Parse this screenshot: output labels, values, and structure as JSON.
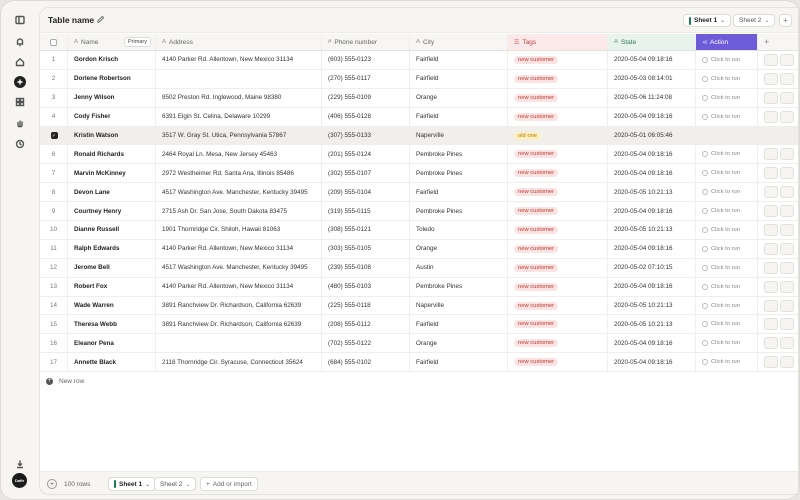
{
  "window": {
    "title": "Table name"
  },
  "sheets": [
    {
      "label": "Sheet 1",
      "active": true
    },
    {
      "label": "Sheet 2",
      "active": false
    }
  ],
  "columns": {
    "name": "Name",
    "primary_badge": "Primary",
    "address": "Address",
    "phone": "Phone number",
    "city": "City",
    "tags": "Tags",
    "state": "State",
    "action": "Action"
  },
  "rows": [
    {
      "idx": "1",
      "name": "Gordon Krisch",
      "address": "4140 Parker Rd. Allentown, New Mexico 31134",
      "phone": "(603) 555-0123",
      "city": "Fairfield",
      "tag": "new customer",
      "state": "2020-05-04 09:18:16",
      "action": "Click to run"
    },
    {
      "idx": "2",
      "name": "Dorlene Robertson",
      "address": "",
      "phone": "(270) 555-0117",
      "city": "Fairfield",
      "tag": "new customer",
      "state": "2020-05-03 08:14:01",
      "action": "Click to run"
    },
    {
      "idx": "3",
      "name": "Jenny Wilson",
      "address": "8502 Preston Rd. Inglewood, Maine 98380",
      "phone": "(229) 555-0109",
      "city": "Orange",
      "tag": "new customer",
      "state": "2020-05-06 11:24:08",
      "action": "Click to run"
    },
    {
      "idx": "4",
      "name": "Cody Fisher",
      "address": "6391 Elgin St. Celina, Delaware 10299",
      "phone": "(406) 555-0128",
      "city": "Fairfield",
      "tag": "new customer",
      "state": "2020-05-04 09:18:16",
      "action": "Click to run"
    },
    {
      "idx": "",
      "name": "Kristin Watson",
      "address": "3517 W. Gray St. Utica, Pennsylvania 57867",
      "phone": "(307) 555-0133",
      "city": "Naperville",
      "tag": "old one",
      "state": "2020-05-01 06:05:46",
      "action": "",
      "selected": true
    },
    {
      "idx": "6",
      "name": "Ronald Richards",
      "address": "2464 Royal Ln. Mesa, New Jersey 45463",
      "phone": "(201) 555-0124",
      "city": "Pembroke Pines",
      "tag": "new customer",
      "state": "2020-05-04 09:18:16",
      "action": "Click to run"
    },
    {
      "idx": "7",
      "name": "Marvin McKinney",
      "address": "2972 Westheimer Rd. Santa Ana, Illinois 85486",
      "phone": "(302) 555-0107",
      "city": "Pembroke Pines",
      "tag": "new customer",
      "state": "2020-05-04 09:18:16",
      "action": "Click to run"
    },
    {
      "idx": "8",
      "name": "Devon Lane",
      "address": "4517 Washington Ave. Manchester, Kentucky 39495",
      "phone": "(209) 555-0104",
      "city": "Fairfield",
      "tag": "new customer",
      "state": "2020-05-05 10:21:13",
      "action": "Click to run"
    },
    {
      "idx": "9",
      "name": "Courtney Henry",
      "address": "2715 Ash Dr. San Jose, South Dakota 83475",
      "phone": "(319) 555-0115",
      "city": "Pembroke Pines",
      "tag": "new customer",
      "state": "2020-05-04 09:18:16",
      "action": "Click to run"
    },
    {
      "idx": "10",
      "name": "Dianne Russell",
      "address": "1901 Thornridge Cir. Shiloh, Hawaii 81063",
      "phone": "(308) 555-0121",
      "city": "Toledo",
      "tag": "new customer",
      "state": "2020-05-05 10:21:13",
      "action": "Click to run"
    },
    {
      "idx": "11",
      "name": "Ralph Edwards",
      "address": "4140 Parker Rd. Allentown, New Mexico 31134",
      "phone": "(303) 555-0105",
      "city": "Orange",
      "tag": "new customer",
      "state": "2020-05-04 09:18:16",
      "action": "Click to run"
    },
    {
      "idx": "12",
      "name": "Jerome Bell",
      "address": "4517 Washington Ave. Manchester, Kentucky 39495",
      "phone": "(239) 555-0108",
      "city": "Austin",
      "tag": "new customer",
      "state": "2020-05-02 07:10:15",
      "action": "Click to run"
    },
    {
      "idx": "13",
      "name": "Robert Fox",
      "address": "4140 Parker Rd. Allentown, New Mexico 31134",
      "phone": "(480) 555-0103",
      "city": "Pembroke Pines",
      "tag": "new customer",
      "state": "2020-05-04 09:18:16",
      "action": "Click to run"
    },
    {
      "idx": "14",
      "name": "Wade Warren",
      "address": "3891 Ranchview Dr. Richardson, California 62639",
      "phone": "(225) 555-0118",
      "city": "Naperville",
      "tag": "new customer",
      "state": "2020-05-05 10:21:13",
      "action": "Click to run"
    },
    {
      "idx": "15",
      "name": "Theresa Webb",
      "address": "3891 Ranchview Dr. Richardson, California 62639",
      "phone": "(208) 555-0112",
      "city": "Fairfield",
      "tag": "new customer",
      "state": "2020-05-05 10:21:13",
      "action": "Click to run"
    },
    {
      "idx": "16",
      "name": "Eleanor Pena",
      "address": "",
      "phone": "(702) 555-0122",
      "city": "Orange",
      "tag": "new customer",
      "state": "2020-05-04 09:18:16",
      "action": "Click to run"
    },
    {
      "idx": "17",
      "name": "Annette Black",
      "address": "2118 Thornridge Cir. Syracuse, Connecticut 35624",
      "phone": "(684) 555-0102",
      "city": "Fairfield",
      "tag": "new customer",
      "state": "2020-05-04 09:18:16",
      "action": "Click to run"
    }
  ],
  "new_row_label": "New row",
  "footer": {
    "row_count": "100 rows",
    "sheet1": "Sheet 1",
    "sheet2": "Sheet 2",
    "add_import": "Add or import"
  },
  "avatar_text": "Daftr",
  "colors": {
    "accent": "#6d5bd8",
    "tag_bg": "#fbe3e3",
    "tag_fg": "#c0392b",
    "state_hdr": "#2f7a52"
  }
}
